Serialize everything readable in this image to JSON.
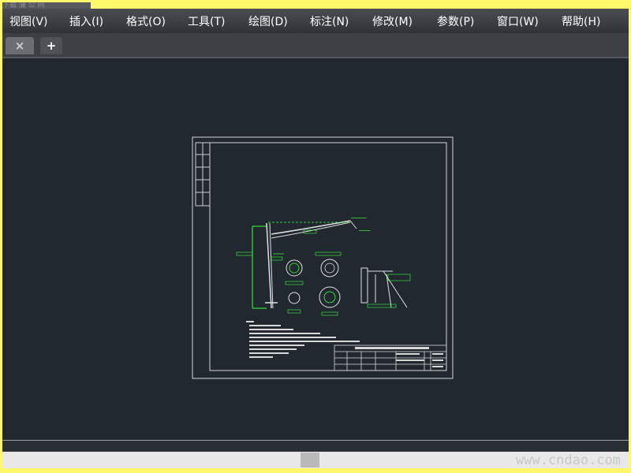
{
  "app": {
    "title_fragment": "下载 蒲 公 网"
  },
  "menu": [
    "视图(V)",
    "插入(I)",
    "格式(O)",
    "工具(T)",
    "绘图(D)",
    "标注(N)",
    "修改(M)",
    "参数(P)",
    "窗口(W)",
    "帮助(H)"
  ],
  "tabs": {
    "close_label": "×",
    "add_label": "+"
  },
  "watermark": "www.cndao.com",
  "colors": {
    "canvas": "#212830",
    "frame": "#fff86a",
    "drawing_lines": "#ffffff",
    "accent": "#3cff3c"
  }
}
